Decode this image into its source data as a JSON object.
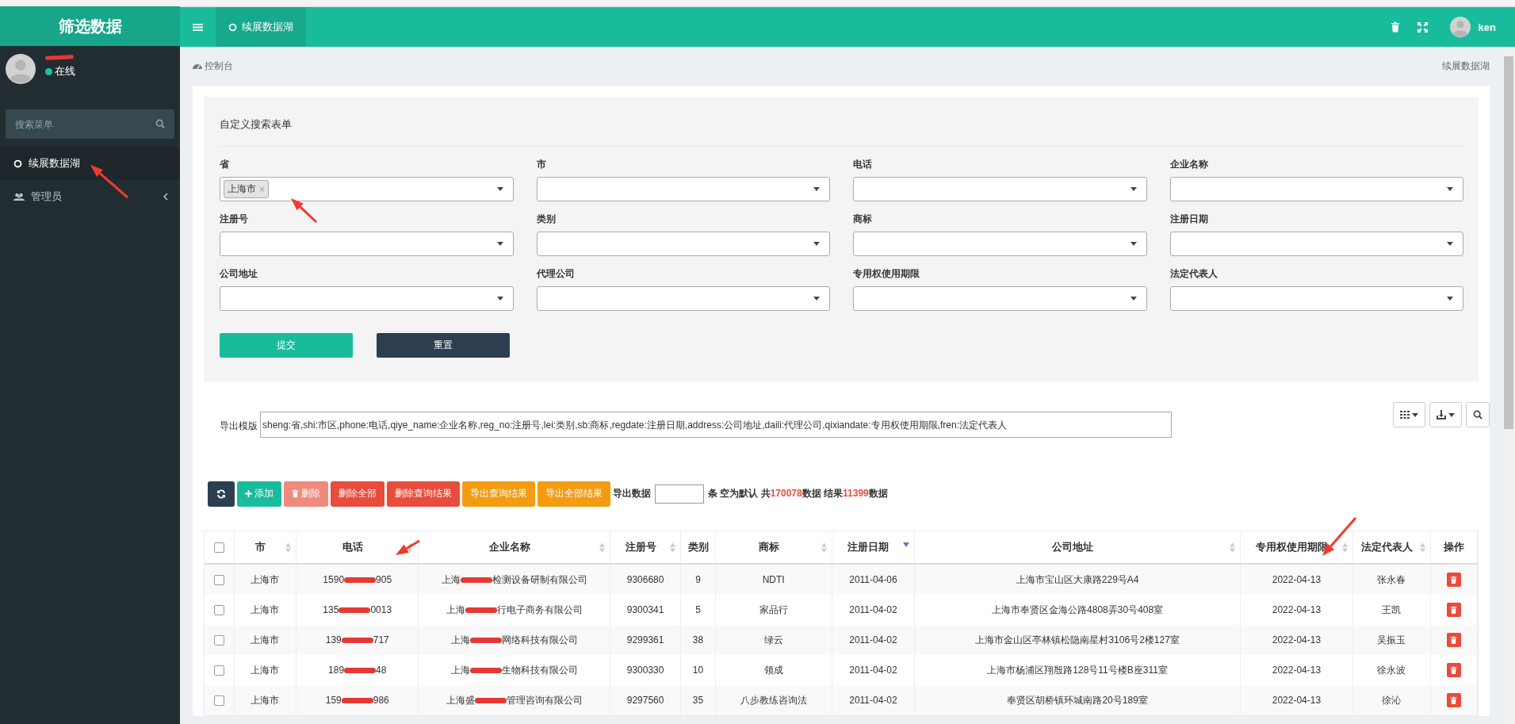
{
  "header": {
    "logo": "筛选数据",
    "tabs": [
      {
        "label": "续展数据湖",
        "selected": true
      }
    ],
    "user": "ken"
  },
  "sidebar": {
    "status": {
      "label": "在线",
      "online": true
    },
    "search": {
      "placeholder": "搜索菜单"
    },
    "items": [
      {
        "label": "续展数据湖",
        "kind": "link",
        "selected": true
      },
      {
        "label": "管理员",
        "kind": "group",
        "selected": false,
        "expanded": false
      }
    ]
  },
  "breadcrumb": {
    "home": "控制台",
    "current": "续展数据湖"
  },
  "search_form": {
    "title": "自定义搜索表单",
    "fields": [
      {
        "label": "省",
        "tags": [
          {
            "label": "上海市",
            "remove": "×"
          }
        ]
      },
      {
        "label": "市"
      },
      {
        "label": "电话"
      },
      {
        "label": "企业名称"
      },
      {
        "label": "注册号"
      },
      {
        "label": "类别"
      },
      {
        "label": "商标"
      },
      {
        "label": "注册日期"
      },
      {
        "label": "公司地址"
      },
      {
        "label": "代理公司"
      },
      {
        "label": "专用权使用期限"
      },
      {
        "label": "法定代表人"
      }
    ],
    "buttons": [
      {
        "label": "提交",
        "kind": "primary"
      },
      {
        "label": "重置",
        "kind": "dark"
      }
    ]
  },
  "export": {
    "label": "导出模版",
    "value": "sheng:省,shi:市区,phone:电话,qiye_name:企业名称,reg_no:注册号,lei:类别,sb:商标,regdate:注册日期,address:公司地址,daili:代理公司,qixiandate:专用权使用期限,fren:法定代表人"
  },
  "toolbar": {
    "buttons": [
      {
        "kind": "refresh",
        "disabled": false
      },
      {
        "kind": "add",
        "label": "添加",
        "disabled": false
      },
      {
        "kind": "delete",
        "label": "删除",
        "disabled": true
      },
      {
        "kind": "danger",
        "label": "删除全部",
        "disabled": false
      },
      {
        "kind": "danger",
        "label": "删除查询结果",
        "disabled": false
      },
      {
        "kind": "warning",
        "label": "导出查询结果",
        "disabled": false
      },
      {
        "kind": "warning",
        "label": "导出全部结果",
        "disabled": false
      }
    ],
    "count_label": "导出数据",
    "summary": [
      {
        "text": "条 空为默认 共",
        "highlight": false
      },
      {
        "text": "170078",
        "highlight": true
      },
      {
        "text": "数据 结果",
        "highlight": false
      },
      {
        "text": "11399",
        "highlight": true
      },
      {
        "text": "数据",
        "highlight": false
      }
    ]
  },
  "table": {
    "select_all": {
      "checked": false
    },
    "columns": [
      {
        "label": "市",
        "sortable": true,
        "sorted_desc": false
      },
      {
        "label": "电话",
        "sortable": true,
        "sorted_desc": false
      },
      {
        "label": "企业名称",
        "sortable": true,
        "sorted_desc": false
      },
      {
        "label": "注册号",
        "sortable": true,
        "sorted_desc": false
      },
      {
        "label": "类别",
        "sortable": false
      },
      {
        "label": "商标",
        "sortable": true,
        "sorted_desc": false
      },
      {
        "label": "注册日期",
        "sortable": true,
        "sorted_desc": true
      },
      {
        "label": "公司地址",
        "sortable": true,
        "sorted_desc": false
      },
      {
        "label": "专用权使用期限",
        "sortable": true,
        "sorted_desc": false
      },
      {
        "label": "法定代表人",
        "sortable": true,
        "sorted_desc": false
      },
      {
        "label": "操作",
        "sortable": false
      }
    ],
    "rows": [
      {
        "checked": false,
        "cells": [
          "上海市",
          {
            "kind": "redacted",
            "before": "1590",
            "after": "905"
          },
          {
            "kind": "redacted",
            "before": "上海",
            "after": "检测设备研制有限公司"
          },
          "9306680",
          "9",
          "NDTI",
          "2011-04-06",
          "上海市宝山区大康路229号A4",
          "2022-04-13",
          "张永春"
        ]
      },
      {
        "checked": false,
        "cells": [
          "上海市",
          {
            "kind": "redacted",
            "before": "135",
            "after": "0013"
          },
          {
            "kind": "redacted",
            "before": "上海",
            "after": "行电子商务有限公司"
          },
          "9300341",
          "5",
          "家品行",
          "2011-04-02",
          "上海市奉贤区金海公路4808弄30号408室",
          "2022-04-13",
          "王凯"
        ]
      },
      {
        "checked": false,
        "cells": [
          "上海市",
          {
            "kind": "redacted",
            "before": "139",
            "after": "717"
          },
          {
            "kind": "redacted",
            "before": "上海",
            "after": "网络科技有限公司"
          },
          "9299361",
          "38",
          "绿云",
          "2011-04-02",
          "上海市金山区亭林镇松隐南星村3106号2楼127室",
          "2022-04-13",
          "吴振玉"
        ]
      },
      {
        "checked": false,
        "cells": [
          "上海市",
          {
            "kind": "redacted",
            "before": "189",
            "after": "48"
          },
          {
            "kind": "redacted",
            "before": "上海",
            "after": "生物科技有限公司"
          },
          "9300330",
          "10",
          "领成",
          "2011-04-02",
          "上海市杨浦区翔殷路128号11号楼B座311室",
          "2022-04-13",
          "徐永波"
        ]
      },
      {
        "checked": false,
        "cells": [
          "上海市",
          {
            "kind": "redacted",
            "before": "159",
            "after": "986"
          },
          {
            "kind": "redacted",
            "before": "上海盛",
            "after": "管理咨询有限公司"
          },
          "9297560",
          "35",
          "八步教练咨询法",
          "2011-04-02",
          "奉贤区胡桥镇环城南路20号189室",
          "2022-04-13",
          "徐沁"
        ]
      }
    ]
  }
}
